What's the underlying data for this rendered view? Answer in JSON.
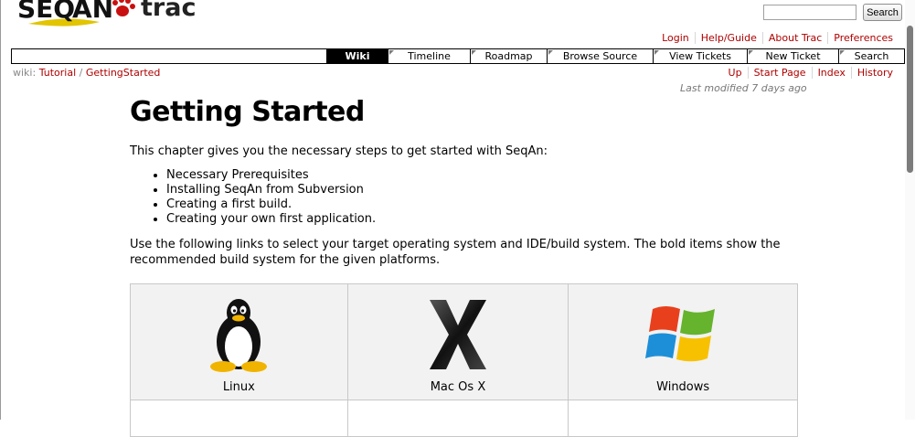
{
  "header": {
    "search_button": "Search"
  },
  "metanav": [
    "Login",
    "Help/Guide",
    "About Trac",
    "Preferences"
  ],
  "mainnav": [
    "Wiki",
    "Timeline",
    "Roadmap",
    "Browse Source",
    "View Tickets",
    "New Ticket",
    "Search"
  ],
  "breadcrumb": {
    "prefix": "wiki:",
    "parts": [
      "Tutorial",
      "GettingStarted"
    ]
  },
  "ctxnav": [
    "Up",
    "Start Page",
    "Index",
    "History"
  ],
  "last_modified": "Last modified 7 days ago",
  "page": {
    "title": "Getting Started",
    "intro": "This chapter gives you the necessary steps to get started with SeqAn:",
    "steps": [
      "Necessary Prerequisites",
      "Installing SeqAn from Subversion",
      "Creating a first build.",
      "Creating your own first application."
    ],
    "paragraph": "Use the following links to select your target operating system and IDE/build system. The bold items show the recommended build system for the given platforms."
  },
  "os_table": {
    "labels": [
      "Linux",
      "Mac Os X",
      "Windows"
    ],
    "icons": [
      "tux-penguin-icon",
      "mac-os-x-icon",
      "windows-logo-icon"
    ]
  },
  "colors": {
    "link": "#b00000",
    "nav_active_bg": "#000000",
    "table_bg": "#f2f2f2"
  }
}
